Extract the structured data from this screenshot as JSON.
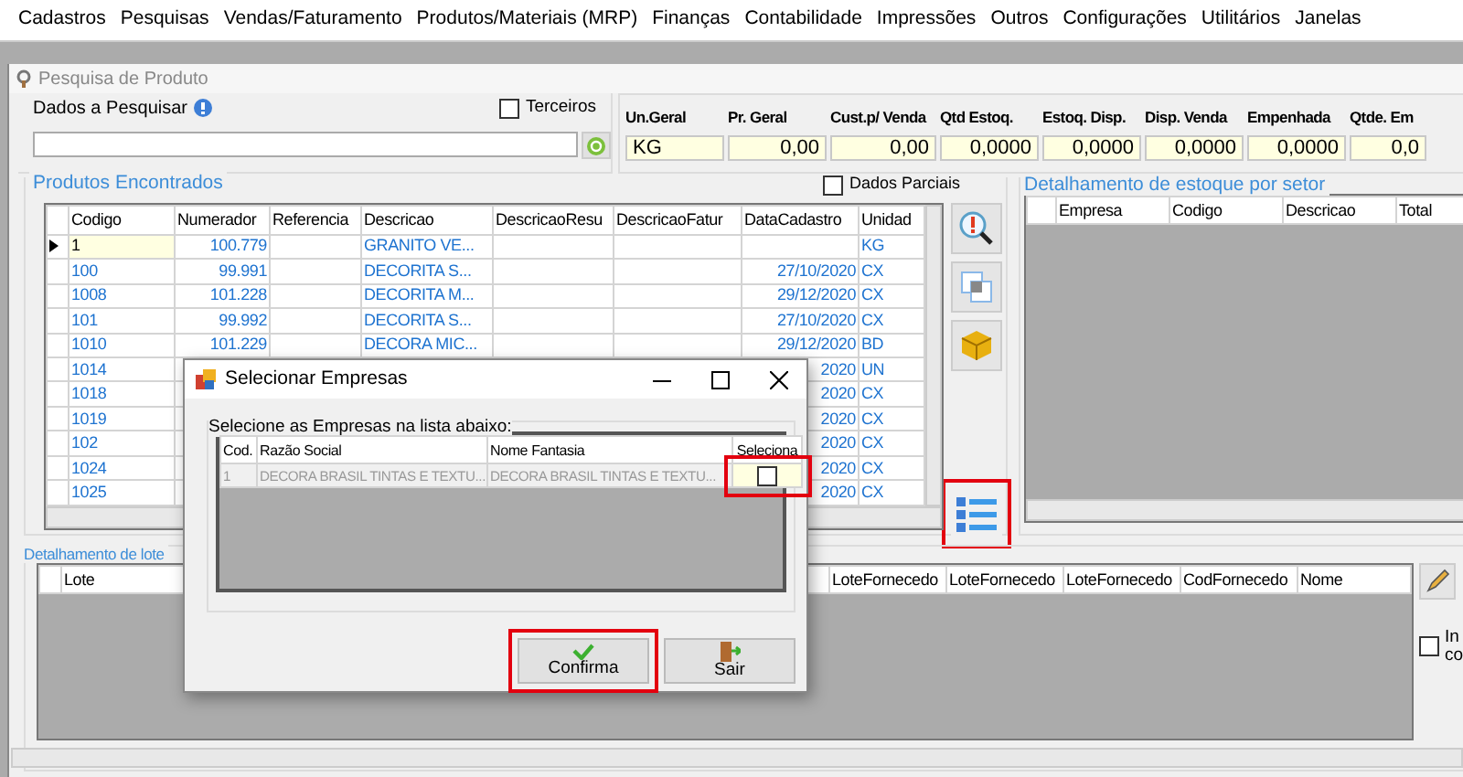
{
  "menu": [
    "Cadastros",
    "Pesquisas",
    "Vendas/Faturamento",
    "Produtos/Materiais (MRP)",
    "Finanças",
    "Contabilidade",
    "Impressões",
    "Outros",
    "Configurações",
    "Utilitários",
    "Janelas"
  ],
  "window": {
    "title": "Pesquisa de Produto"
  },
  "search": {
    "label": "Dados a Pesquisar",
    "terceiros": {
      "label": "Terceiros",
      "checked": false
    }
  },
  "summary": [
    {
      "label": "Un.Geral",
      "value": "KG",
      "kind": "text"
    },
    {
      "label": "Pr. Geral",
      "value": "0,00",
      "kind": "number"
    },
    {
      "label": "Cust.p/ Venda",
      "value": "0,00",
      "kind": "number"
    },
    {
      "label": "Qtd Estoq.",
      "value": "0,0000",
      "kind": "number"
    },
    {
      "label": "Estoq. Disp.",
      "value": "0,0000",
      "kind": "number"
    },
    {
      "label": "Disp. Venda",
      "value": "0,0000",
      "kind": "number"
    },
    {
      "label": "Empenhada",
      "value": "0,0000",
      "kind": "number"
    },
    {
      "label": "Qtde. Em",
      "value": "0,0",
      "kind": "number"
    }
  ],
  "products": {
    "title": "Produtos Encontrados",
    "dados_parciais": {
      "label": "Dados Parciais",
      "checked": false
    },
    "columns": [
      "Codigo",
      "Numerador",
      "Referencia",
      "Descricao",
      "DescricaoResu",
      "DescricaoFatur",
      "DataCadastro",
      "Unidad"
    ],
    "rows": [
      {
        "codigo": "1",
        "numerador": "100.779",
        "descricao": "GRANITO VE...",
        "unidade": "KG",
        "selected": true
      },
      {
        "codigo": "100",
        "numerador": "99.991",
        "descricao": "DECORITA S...",
        "data": "27/10/2020",
        "unidade": "CX",
        "selected": false
      },
      {
        "codigo": "1008",
        "numerador": "101.228",
        "descricao": "DECORITA M...",
        "data": "29/12/2020",
        "unidade": "CX",
        "selected": false
      },
      {
        "codigo": "101",
        "numerador": "99.992",
        "descricao": "DECORITA S...",
        "data": "27/10/2020",
        "unidade": "CX",
        "selected": false
      },
      {
        "codigo": "1010",
        "numerador": "101.229",
        "descricao": "DECORA MIC...",
        "data": "29/12/2020",
        "unidade": "BD",
        "selected": false
      },
      {
        "codigo": "1014",
        "data": "2020",
        "unidade": "UN",
        "selected": false
      },
      {
        "codigo": "1018",
        "data": "2020",
        "unidade": "CX",
        "selected": false
      },
      {
        "codigo": "1019",
        "data": "2020",
        "unidade": "CX",
        "selected": false
      },
      {
        "codigo": "102",
        "data": "2020",
        "unidade": "CX",
        "selected": false
      },
      {
        "codigo": "1024",
        "data": "2020",
        "unidade": "CX",
        "selected": false
      },
      {
        "codigo": "1025",
        "data": "2020",
        "unidade": "CX",
        "selected": false
      }
    ]
  },
  "tools": [
    {
      "kind": "search"
    },
    {
      "kind": "copy"
    },
    {
      "kind": "box"
    },
    {
      "kind": "list",
      "highlighted": true
    }
  ],
  "estoque": {
    "title": "Detalhamento de estoque por setor",
    "columns": [
      "Empresa",
      "Codigo",
      "Descricao",
      "Total"
    ]
  },
  "lote": {
    "title": "Detalhamento de lote",
    "columns": [
      "Lote",
      "LoteFornecedo",
      "LoteFornecedo",
      "LoteFornecedo",
      "CodFornecedo",
      "Nome"
    ],
    "option": {
      "lines": [
        "In",
        "co"
      ],
      "checked": false
    }
  },
  "dialog": {
    "title": "Selecionar Empresas",
    "group": "Selecione as Empresas na lista abaixo:",
    "columns": [
      "Cod.",
      "Razão Social",
      "Nome Fantasia",
      "Seleciona"
    ],
    "rows": [
      {
        "cod": "1",
        "razao": "DECORA BRASIL TINTAS E TEXTU...",
        "fantasia": "DECORA BRASIL TINTAS E TEXTU...",
        "checked": false,
        "highlighted": true
      }
    ],
    "buttons": [
      {
        "label": "Confirma",
        "kind": "confirm",
        "highlighted": true
      },
      {
        "label": "Sair",
        "kind": "exit",
        "highlighted": false
      }
    ]
  }
}
